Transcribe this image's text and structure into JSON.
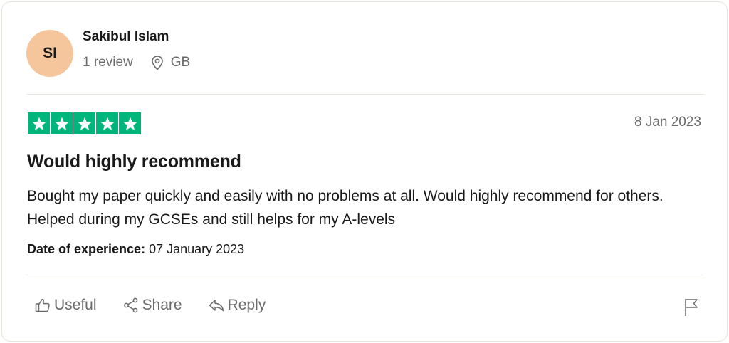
{
  "reviewer": {
    "initials": "SI",
    "avatar_color": "#f5c69c",
    "name": "Sakibul Islam",
    "review_count": "1 review",
    "country": "GB"
  },
  "review": {
    "rating": 5,
    "max_rating": 5,
    "star_color": "#00b67a",
    "date": "8 Jan 2023",
    "title": "Would highly recommend",
    "body": "Bought my paper quickly and easily with no problems at all. Would highly recommend for others. Helped during my GCSEs and still helps for my A-levels",
    "experience_label": "Date of experience:",
    "experience_date": "07 January 2023"
  },
  "actions": {
    "useful": "Useful",
    "share": "Share",
    "reply": "Reply"
  },
  "icons": {
    "location": "location-pin-icon",
    "useful": "thumbs-up-icon",
    "share": "share-icon",
    "reply": "reply-arrow-icon",
    "report": "flag-icon"
  }
}
